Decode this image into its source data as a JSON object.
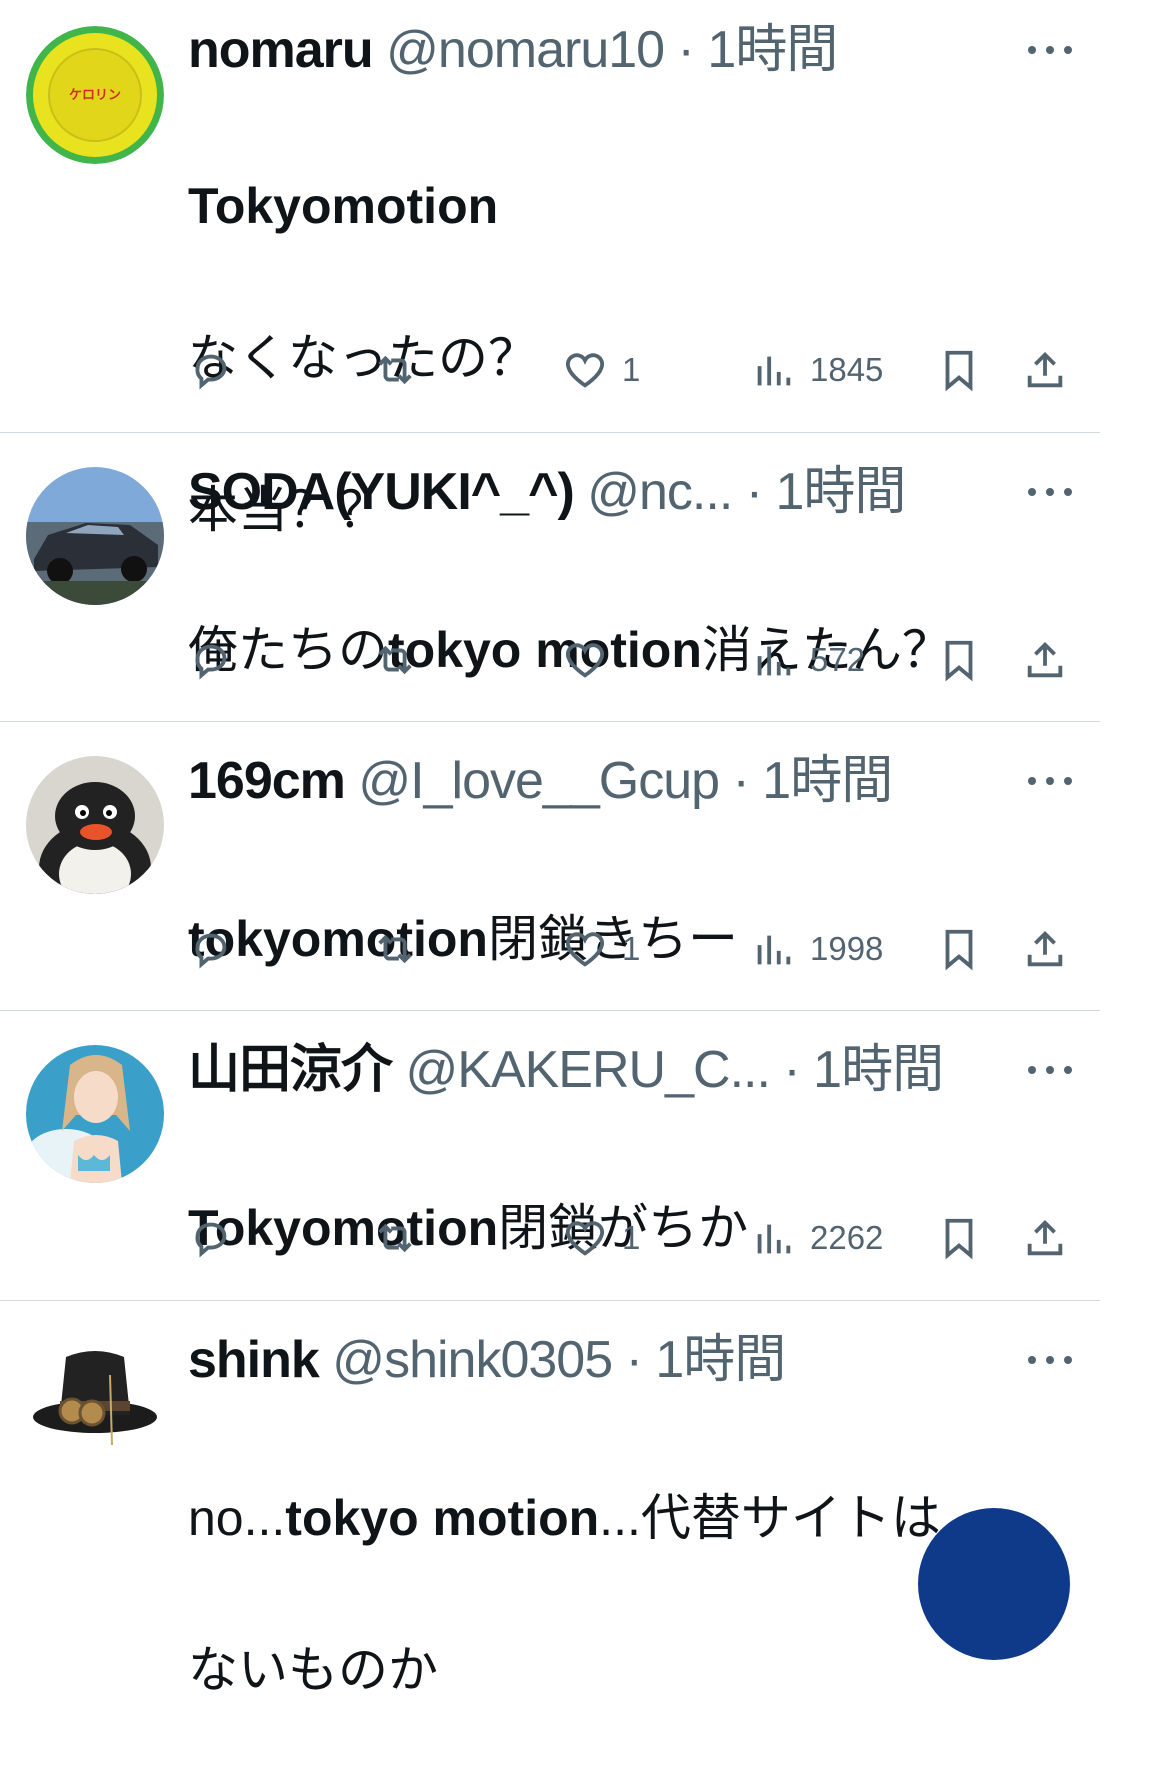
{
  "tweets": [
    {
      "name": "nomaru",
      "handle": "@nomaru10",
      "sep": "·",
      "time": "1時間",
      "avatar_icon": "yellow-dish-avatar-icon",
      "text_line1": "Tokyomotion",
      "text_line2": "なくなったの？",
      "text_line3": "本当？？",
      "likes": "1",
      "views": "1845"
    },
    {
      "name": "SODA(YUKI^_^)",
      "handle": "@nc...",
      "sep": "·",
      "time": "1時間",
      "avatar_icon": "car-avatar-icon",
      "text_pre": "俺たちの",
      "text_bold": "tokyo motion",
      "text_post": "消えたん？",
      "likes": "",
      "views": "572"
    },
    {
      "name": "169cm",
      "handle": "@I_love__Gcup",
      "sep": "·",
      "time": "1時間",
      "avatar_icon": "penguin-avatar-icon",
      "text_bold": "tokyomotion",
      "text_post": "閉鎖きちー",
      "likes": "1",
      "views": "1998"
    },
    {
      "name": "山田涼介",
      "handle": "@KAKERU_C...",
      "sep": "·",
      "time": "1時間",
      "avatar_icon": "anime-girl-avatar-icon",
      "text_bold": "Tokyomotion",
      "text_post": "閉鎖がちか",
      "likes": "1",
      "views": "2262"
    },
    {
      "name": "shink",
      "handle": "@shink0305",
      "sep": "·",
      "time": "1時間",
      "avatar_icon": "steampunk-hat-avatar-icon",
      "text_a": "no...",
      "text_b": "tokyo motion",
      "text_c": "...代替サイトは",
      "text_line2": "ないものか"
    }
  ],
  "colors": {
    "text": "#0f1419",
    "secondary": "#536471",
    "divider": "#cfd9de",
    "fab": "#0f3a8a"
  }
}
